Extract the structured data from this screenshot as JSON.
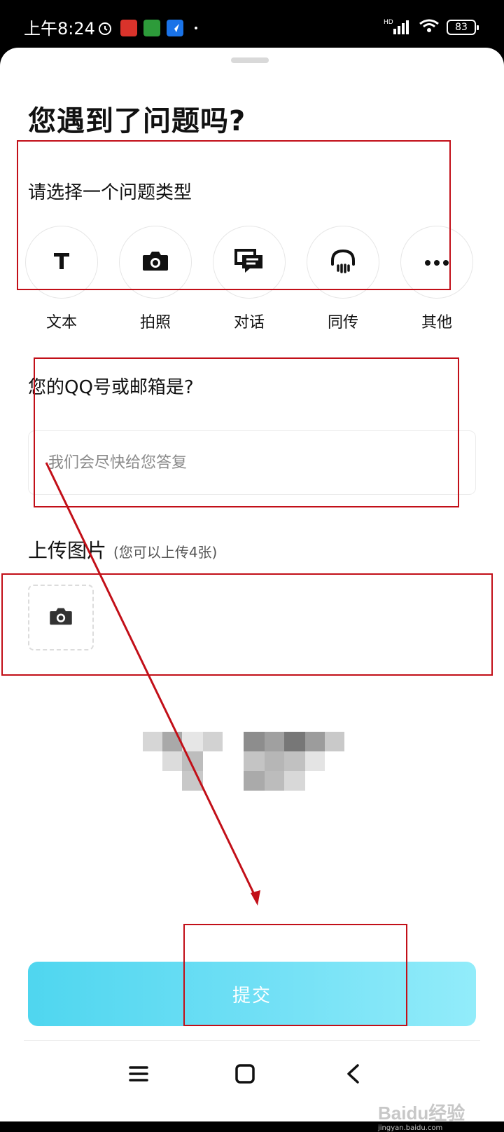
{
  "status_bar": {
    "time": "上午8:24",
    "hd_label": "HD",
    "battery": "83",
    "app_icon_colors": [
      "#ffffff",
      "#d9332b",
      "#2d9b3a",
      "#1a73e8"
    ]
  },
  "sheet": {
    "title": "您遇到了问题吗?"
  },
  "issue_type": {
    "prompt": "请选择一个问题类型",
    "options": [
      {
        "label": "文本",
        "icon": "text-t-icon"
      },
      {
        "label": "拍照",
        "icon": "camera-icon"
      },
      {
        "label": "对话",
        "icon": "chat-bubble-icon"
      },
      {
        "label": "同传",
        "icon": "headset-icon"
      },
      {
        "label": "其他",
        "icon": "more-dots-icon"
      }
    ]
  },
  "contact": {
    "label": "您的QQ号或邮箱是?",
    "placeholder": "我们会尽快给您答复",
    "value": ""
  },
  "upload": {
    "title": "上传图片",
    "hint": "(您可以上传4张)",
    "icon": "camera-icon"
  },
  "submit": {
    "label": "提交"
  },
  "nav_bar": {
    "menu_icon": "menu-icon",
    "home_icon": "home-icon",
    "back_icon": "back-icon"
  },
  "watermark": {
    "text": "Baidu经验",
    "sub": "jingyan.baidu.com"
  },
  "colors": {
    "annotation": "#c20f18",
    "button_gradient_start": "#4fd6ef",
    "button_gradient_end": "#92ecfa"
  }
}
